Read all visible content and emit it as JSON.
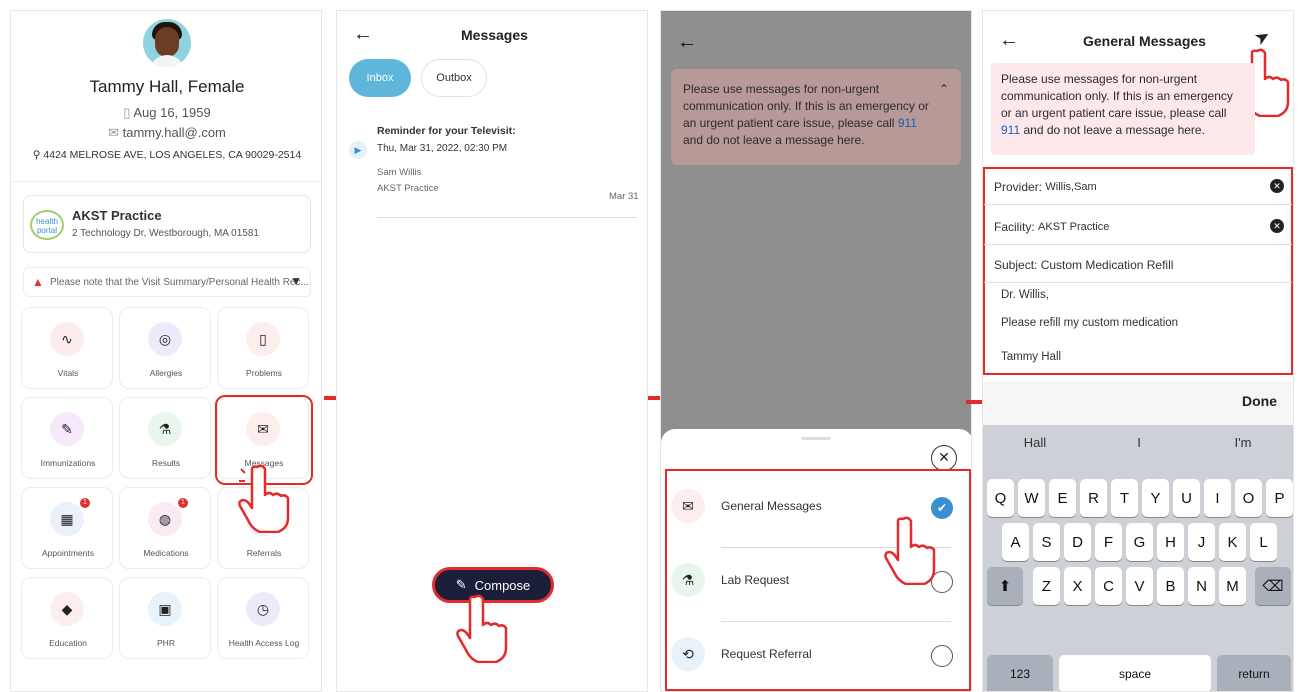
{
  "panel1": {
    "patient_name": "Tammy Hall, Female",
    "dob": "Aug 16, 1959",
    "email": "tammy.hall@.com",
    "address": "4424 MELROSE AVE, LOS ANGELES, CA 90029-2514",
    "practice_logo_text": "health portal",
    "practice_name": "AKST Practice",
    "practice_address": "2 Technology Dr, Westborough, MA 01581",
    "notice": "Please note that the Visit Summary/Personal Health Rec...",
    "tiles": [
      {
        "label": "Vitals",
        "icon": "heartbeat-icon",
        "color": "#fdecec",
        "glyph": "∿"
      },
      {
        "label": "Allergies",
        "icon": "allergy-icon",
        "color": "#eeeafc",
        "glyph": "◎"
      },
      {
        "label": "Problems",
        "icon": "document-icon",
        "color": "#fdeeee",
        "glyph": "▯"
      },
      {
        "label": "Immunizations",
        "icon": "syringe-icon",
        "color": "#f7e8fb",
        "glyph": "✎"
      },
      {
        "label": "Results",
        "icon": "flask-icon",
        "color": "#e8f6ec",
        "glyph": "⚗"
      },
      {
        "label": "Messages",
        "icon": "envelope-icon",
        "color": "#fdeeee",
        "glyph": "✉"
      },
      {
        "label": "Appointments",
        "icon": "calendar-icon",
        "color": "#eaf1fb",
        "glyph": "▦",
        "badge": "1"
      },
      {
        "label": "Medications",
        "icon": "pills-icon",
        "color": "#fbe9f3",
        "glyph": "◍",
        "badge": "1"
      },
      {
        "label": "Referrals",
        "icon": "referral-icon",
        "color": "#eef0fb",
        "glyph": "↗"
      },
      {
        "label": "Education",
        "icon": "graduation-cap-icon",
        "color": "#fdeeee",
        "glyph": "◆"
      },
      {
        "label": "PHR",
        "icon": "phr-icon",
        "color": "#e8f2fb",
        "glyph": "▣"
      },
      {
        "label": "Health Access Log",
        "icon": "access-log-icon",
        "color": "#eeeafc",
        "glyph": "◷"
      }
    ]
  },
  "panel2": {
    "title": "Messages",
    "tab_inbox": "Inbox",
    "tab_outbox": "Outbox",
    "message": {
      "subject": "Reminder for your Televisit:",
      "datetime": "Thu, Mar 31, 2022, 02:30 PM",
      "from": "Sam Willis",
      "practice": "AKST Practice",
      "date": "Mar 31"
    },
    "compose_label": "Compose"
  },
  "panel3": {
    "warning_pre": "Please use messages for non-urgent communication only. If this is an emergency or an urgent patient care issue, please call ",
    "warning_number": "911",
    "warning_post": " and do not leave a message here.",
    "options": [
      {
        "label": "General Messages",
        "icon": "envelope-icon",
        "color": "#fdeeee",
        "glyph": "✉",
        "selected": true
      },
      {
        "label": "Lab Request",
        "icon": "flask-icon",
        "color": "#e8f6ec",
        "glyph": "⚗",
        "selected": false
      },
      {
        "label": "Request Referral",
        "icon": "referral-icon",
        "color": "#e8f2fb",
        "glyph": "⟲",
        "selected": false
      }
    ]
  },
  "panel4": {
    "title": "General Messages",
    "warning_pre": "Please use messages for non-urgent communication only. If this is an emergency or an urgent patient care issue, please call ",
    "warning_number": "911",
    "warning_post": " and do not leave a message here.",
    "provider_label": "Provider:",
    "provider_value": "Willis,Sam",
    "facility_label": "Facility:",
    "facility_value": "AKST Practice",
    "subject_label": "Subject:",
    "subject_value": "Custom Medication Refill",
    "body_greeting": "Dr. Willis,",
    "body_text": "Please refill my custom medication",
    "body_signature": "Tammy Hall",
    "done_label": "Done",
    "suggestions": [
      "Hall",
      "I",
      "I'm"
    ],
    "row1": [
      "Q",
      "W",
      "E",
      "R",
      "T",
      "Y",
      "U",
      "I",
      "O",
      "P"
    ],
    "row2": [
      "A",
      "S",
      "D",
      "F",
      "G",
      "H",
      "J",
      "K",
      "L"
    ],
    "row3": [
      "Z",
      "X",
      "C",
      "V",
      "B",
      "N",
      "M"
    ],
    "key_123": "123",
    "key_space": "space",
    "key_return": "return"
  },
  "colors": {
    "accent_red": "#e42a2a",
    "inbox_blue": "#5fb6db",
    "compose_bg": "#1b1f3a",
    "check_blue": "#3a8fd1"
  }
}
